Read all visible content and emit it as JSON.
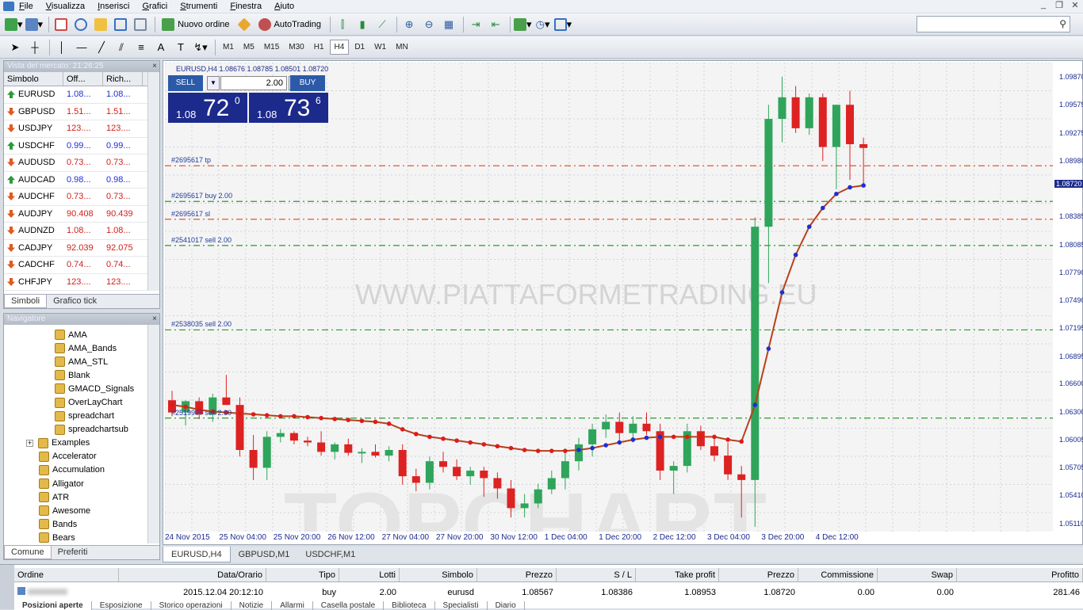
{
  "menu": [
    "File",
    "Visualizza",
    "Inserisci",
    "Grafici",
    "Strumenti",
    "Finestra",
    "Aiuto"
  ],
  "toolbar": {
    "new_order": "Nuovo ordine",
    "autotrading": "AutoTrading"
  },
  "timeframes": [
    "M1",
    "M5",
    "M15",
    "M30",
    "H1",
    "H4",
    "D1",
    "W1",
    "MN"
  ],
  "active_timeframe": "H4",
  "market_watch": {
    "title": "Vista del mercato: 21:26:25",
    "headers": [
      "Simbolo",
      "Off...",
      "Rich..."
    ],
    "rows": [
      {
        "sym": "EURUSD",
        "bid": "1.08...",
        "ask": "1.08...",
        "dir": "up",
        "color": "blue"
      },
      {
        "sym": "GBPUSD",
        "bid": "1.51...",
        "ask": "1.51...",
        "dir": "down",
        "color": "red"
      },
      {
        "sym": "USDJPY",
        "bid": "123....",
        "ask": "123....",
        "dir": "down",
        "color": "red"
      },
      {
        "sym": "USDCHF",
        "bid": "0.99...",
        "ask": "0.99...",
        "dir": "up",
        "color": "blue"
      },
      {
        "sym": "AUDUSD",
        "bid": "0.73...",
        "ask": "0.73...",
        "dir": "down",
        "color": "red"
      },
      {
        "sym": "AUDCAD",
        "bid": "0.98...",
        "ask": "0.98...",
        "dir": "up",
        "color": "blue"
      },
      {
        "sym": "AUDCHF",
        "bid": "0.73...",
        "ask": "0.73...",
        "dir": "down",
        "color": "red"
      },
      {
        "sym": "AUDJPY",
        "bid": "90.408",
        "ask": "90.439",
        "dir": "down",
        "color": "red"
      },
      {
        "sym": "AUDNZD",
        "bid": "1.08...",
        "ask": "1.08...",
        "dir": "down",
        "color": "red"
      },
      {
        "sym": "CADJPY",
        "bid": "92.039",
        "ask": "92.075",
        "dir": "down",
        "color": "red"
      },
      {
        "sym": "CADCHF",
        "bid": "0.74...",
        "ask": "0.74...",
        "dir": "down",
        "color": "red"
      },
      {
        "sym": "CHFJPY",
        "bid": "123....",
        "ask": "123....",
        "dir": "down",
        "color": "red"
      }
    ],
    "tabs": [
      "Simboli",
      "Grafico tick"
    ]
  },
  "navigator": {
    "title": "Navigatore",
    "items": [
      {
        "label": "AMA",
        "level": 2
      },
      {
        "label": "AMA_Bands",
        "level": 2
      },
      {
        "label": "AMA_STL",
        "level": 2
      },
      {
        "label": "Blank",
        "level": 2
      },
      {
        "label": "GMACD_Signals",
        "level": 2
      },
      {
        "label": "OverLayChart",
        "level": 2
      },
      {
        "label": "spreadchart",
        "level": 2
      },
      {
        "label": "spreadchartsub",
        "level": 2
      },
      {
        "label": "Examples",
        "level": 1
      },
      {
        "label": "Accelerator",
        "level": 1
      },
      {
        "label": "Accumulation",
        "level": 1
      },
      {
        "label": "Alligator",
        "level": 1
      },
      {
        "label": "ATR",
        "level": 1
      },
      {
        "label": "Awesome",
        "level": 1
      },
      {
        "label": "Bands",
        "level": 1
      },
      {
        "label": "Bears",
        "level": 1
      }
    ],
    "tabs": [
      "Comune",
      "Preferiti"
    ]
  },
  "chart": {
    "header": "EURUSD,H4  1.08676 1.08785 1.08501 1.08720",
    "sell_label": "SELL",
    "buy_label": "BUY",
    "volume": "2.00",
    "sell_price": {
      "small": "1.08",
      "big": "72",
      "sup": "0"
    },
    "buy_price": {
      "small": "1.08",
      "big": "73",
      "sup": "6"
    },
    "watermark": "WWW.PIATTAFORMETRADING.EU",
    "watermark2": "TOPCHART",
    "current_price": "1.08720",
    "price_axis": [
      "1.09870",
      "1.09575",
      "1.09275",
      "1.08980",
      "1.08385",
      "1.08085",
      "1.07790",
      "1.07490",
      "1.07195",
      "1.06895",
      "1.06600",
      "1.06300",
      "1.06005",
      "1.05705",
      "1.05410",
      "1.05110"
    ],
    "time_axis": [
      "24 Nov 2015",
      "25 Nov 04:00",
      "25 Nov 20:00",
      "26 Nov 12:00",
      "27 Nov 04:00",
      "27 Nov 20:00",
      "30 Nov 12:00",
      "1 Dec 04:00",
      "1 Dec 20:00",
      "2 Dec 12:00",
      "3 Dec 04:00",
      "3 Dec 20:00",
      "4 Dec 12:00"
    ],
    "order_lines": [
      {
        "label": "#2695617 tp",
        "price": 1.0895,
        "color": "#e05a2a"
      },
      {
        "label": "#2695617 buy 2.00",
        "price": 1.0857,
        "color": "#2a9a2a"
      },
      {
        "label": "#2695617 sl",
        "price": 1.0838,
        "color": "#e05a2a"
      },
      {
        "label": "#2541017 sell 2.00",
        "price": 1.081,
        "color": "#2a9a2a"
      },
      {
        "label": "#2538035 sell 2.00",
        "price": 1.072,
        "color": "#2a9a2a"
      },
      {
        "label": "#2519907 sell 2.00",
        "price": 1.0626,
        "color": "#2a9a2a"
      }
    ]
  },
  "chart_data": {
    "type": "candlestick",
    "symbol": "EURUSD",
    "timeframe": "H4",
    "ylim": [
      1.0505,
      1.1005
    ],
    "candles": [
      [
        1.0645,
        1.0655,
        1.0628,
        1.0632
      ],
      [
        1.0632,
        1.0645,
        1.0618,
        1.0644
      ],
      [
        1.0644,
        1.0648,
        1.0625,
        1.063
      ],
      [
        1.063,
        1.0652,
        1.0622,
        1.0648
      ],
      [
        1.0648,
        1.0672,
        1.064,
        1.064
      ],
      [
        1.064,
        1.0648,
        1.0585,
        1.0592
      ],
      [
        1.0592,
        1.0608,
        1.056,
        1.0573
      ],
      [
        1.0573,
        1.0612,
        1.056,
        1.0606
      ],
      [
        1.0606,
        1.0614,
        1.06,
        1.061
      ],
      [
        1.061,
        1.0612,
        1.0598,
        1.0602
      ],
      [
        1.0602,
        1.0606,
        1.0596,
        1.06
      ],
      [
        1.06,
        1.0612,
        1.0586,
        1.059
      ],
      [
        1.059,
        1.06,
        1.0582,
        1.0598
      ],
      [
        1.0598,
        1.0604,
        1.0586,
        1.0589
      ],
      [
        1.0589,
        1.0594,
        1.0578,
        1.059
      ],
      [
        1.059,
        1.0598,
        1.0584,
        1.0586
      ],
      [
        1.0586,
        1.0596,
        1.058,
        1.0592
      ],
      [
        1.0592,
        1.0598,
        1.0555,
        1.0564
      ],
      [
        1.0564,
        1.0572,
        1.0548,
        1.0557
      ],
      [
        1.0557,
        1.0585,
        1.055,
        1.058
      ],
      [
        1.058,
        1.059,
        1.0568,
        1.0574
      ],
      [
        1.0574,
        1.0582,
        1.056,
        1.0564
      ],
      [
        1.0564,
        1.0574,
        1.0555,
        1.057
      ],
      [
        1.057,
        1.0574,
        1.0542,
        1.0562
      ],
      [
        1.0562,
        1.0568,
        1.054,
        1.0551
      ],
      [
        1.0551,
        1.056,
        1.052,
        1.053
      ],
      [
        1.053,
        1.0545,
        1.052,
        1.0535
      ],
      [
        1.0535,
        1.0556,
        1.053,
        1.055
      ],
      [
        1.055,
        1.057,
        1.0545,
        1.0562
      ],
      [
        1.0562,
        1.059,
        1.055,
        1.058
      ],
      [
        1.058,
        1.0605,
        1.057,
        1.0598
      ],
      [
        1.0598,
        1.062,
        1.0585,
        1.0614
      ],
      [
        1.0614,
        1.063,
        1.0605,
        1.0622
      ],
      [
        1.0622,
        1.0632,
        1.0598,
        1.061
      ],
      [
        1.061,
        1.0628,
        1.06,
        1.062
      ],
      [
        1.062,
        1.0632,
        1.0608,
        1.0612
      ],
      [
        1.0612,
        1.062,
        1.056,
        1.057
      ],
      [
        1.057,
        1.058,
        1.0545,
        1.0575
      ],
      [
        1.0575,
        1.062,
        1.0568,
        1.0612
      ],
      [
        1.0612,
        1.0618,
        1.0592,
        1.0596
      ],
      [
        1.0596,
        1.0608,
        1.058,
        1.0586
      ],
      [
        1.0586,
        1.06,
        1.056,
        1.0566
      ],
      [
        1.0566,
        1.0575,
        1.052,
        1.056
      ],
      [
        1.056,
        1.084,
        1.051,
        1.083
      ],
      [
        1.083,
        1.096,
        1.077,
        1.0945
      ],
      [
        1.0945,
        1.099,
        1.092,
        1.0968
      ],
      [
        1.0968,
        1.098,
        1.093,
        1.0935
      ],
      [
        1.0935,
        1.0972,
        1.0928,
        1.0968
      ],
      [
        1.0968,
        1.0972,
        1.09,
        1.0915
      ],
      [
        1.0915,
        1.096,
        1.087,
        1.096
      ],
      [
        1.096,
        1.0975,
        1.088,
        1.0918
      ],
      [
        1.0918,
        1.0925,
        1.0875,
        1.0914
      ]
    ],
    "ma": [
      1.064,
      1.0638,
      1.0635,
      1.0633,
      1.0632,
      1.0631,
      1.063,
      1.0629,
      1.0628,
      1.0628,
      1.0627,
      1.0626,
      1.0625,
      1.0624,
      1.0623,
      1.0622,
      1.062,
      1.0614,
      1.0609,
      1.0606,
      1.0604,
      1.0602,
      1.06,
      1.0598,
      1.0596,
      1.0594,
      1.0592,
      1.0591,
      1.0591,
      1.0591,
      1.0592,
      1.0594,
      1.0597,
      1.06,
      1.0603,
      1.0605,
      1.0606,
      1.0606,
      1.0606,
      1.0606,
      1.0606,
      1.0603,
      1.0601,
      1.064,
      1.07,
      1.076,
      1.08,
      1.083,
      1.085,
      1.0865,
      1.0872,
      1.0874
    ],
    "ma_color": "#b8401a",
    "bull_color": "#2ea55a",
    "bear_color": "#dd2222"
  },
  "chart_tabs": [
    "EURUSD,H4",
    "GBPUSD,M1",
    "USDCHF,M1"
  ],
  "terminal": {
    "headers": [
      "Ordine",
      "Data/Orario",
      "Tipo",
      "Lotti",
      "Simbolo",
      "Prezzo",
      "S / L",
      "Take profit",
      "Prezzo",
      "Commissione",
      "Swap",
      "Profitto"
    ],
    "row": [
      "",
      "2015.12.04 20:12:10",
      "buy",
      "2.00",
      "eurusd",
      "1.08567",
      "1.08386",
      "1.08953",
      "1.08720",
      "0.00",
      "0.00",
      "281.46"
    ],
    "tabs": [
      "Posizioni aperte",
      "Esposizione",
      "Storico operazioni",
      "Notizie",
      "Allarmi",
      "Casella postale",
      "Biblioteca",
      "Specialisti",
      "Diario"
    ]
  }
}
